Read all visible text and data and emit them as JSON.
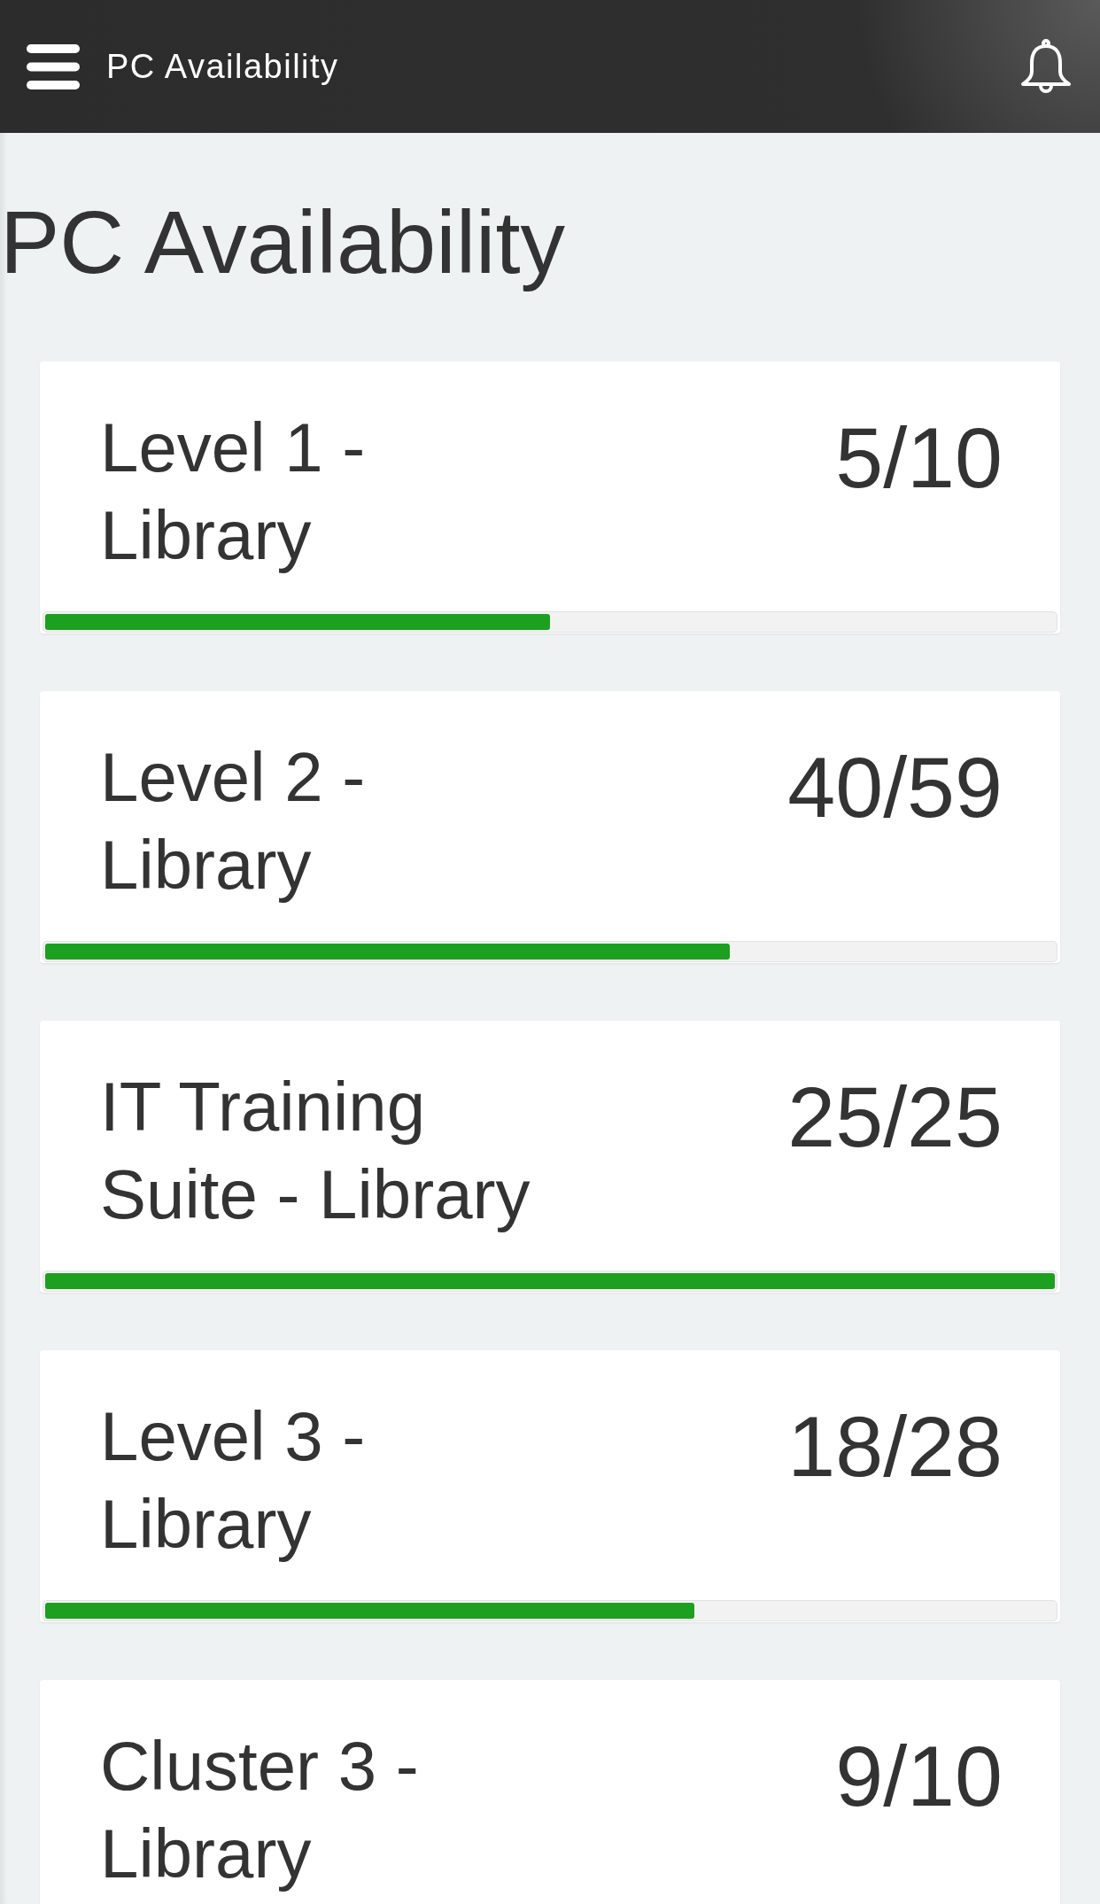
{
  "app_bar": {
    "title": "PC Availability"
  },
  "page": {
    "heading": "PC Availability"
  },
  "locations": [
    {
      "name": "Level 1 - Library",
      "count": "5/10",
      "level": 0.5
    },
    {
      "name": "Level 2 - Library",
      "count": "40/59",
      "level": 0.678
    },
    {
      "name": "IT Training Suite - Library",
      "count": "25/25",
      "level": 1
    },
    {
      "name": "Level 3 - Library",
      "count": "18/28",
      "level": 0.643
    },
    {
      "name": "Cluster 3 - Library",
      "count": "9/10"
    }
  ]
}
